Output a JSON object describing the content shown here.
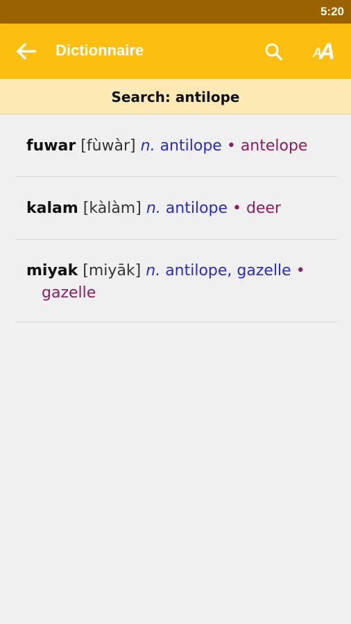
{
  "status_bar": {
    "time": "5:20"
  },
  "app_bar": {
    "title": "Dictionnaire",
    "font_small": "A",
    "font_big": "A"
  },
  "search": {
    "label": "Search: antilope"
  },
  "entries": [
    {
      "word": "fuwar",
      "pron": "[fùwàr]",
      "pos": "n.",
      "gloss": "antilope",
      "bullet": "•",
      "trans": "antelope"
    },
    {
      "word": "kalam",
      "pron": "[kàlàm]",
      "pos": "n.",
      "gloss": "antilope",
      "bullet": "•",
      "trans": "deer"
    },
    {
      "word": "miyak",
      "pron": "[miyāk]",
      "pos": "n.",
      "gloss": "antilope, gazelle",
      "bullet": "•",
      "trans": "gazelle"
    }
  ],
  "colors": {
    "status_bar": "#9b6200",
    "app_bar": "#fdbf0f",
    "banner": "#fde9b3",
    "gloss": "#2a2ad0",
    "translation": "#8b1e5e"
  }
}
